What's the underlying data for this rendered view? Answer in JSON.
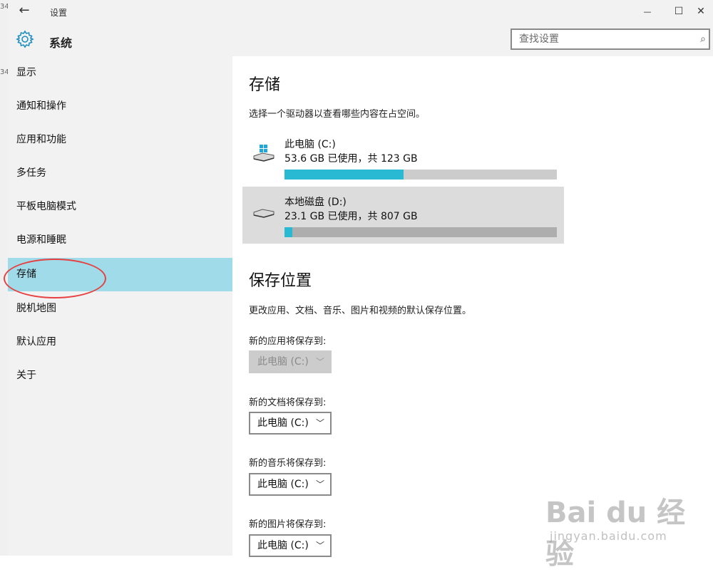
{
  "behind": {
    "texts": [
      "34",
      "34"
    ]
  },
  "window": {
    "title": "设置",
    "back_glyph": "←",
    "minimize": "—",
    "maximize": "☐",
    "close": "✕"
  },
  "header": {
    "title": "系统",
    "search_placeholder": "查找设置"
  },
  "sidebar": {
    "items": [
      {
        "label": "显示"
      },
      {
        "label": "通知和操作"
      },
      {
        "label": "应用和功能"
      },
      {
        "label": "多任务"
      },
      {
        "label": "平板电脑模式"
      },
      {
        "label": "电源和睡眠"
      },
      {
        "label": "存储",
        "active": true
      },
      {
        "label": "脱机地图"
      },
      {
        "label": "默认应用"
      },
      {
        "label": "关于"
      }
    ]
  },
  "storage": {
    "title": "存储",
    "description": "选择一个驱动器以查看哪些内容在占空间。",
    "drives": [
      {
        "name": "此电脑 (C:)",
        "usage": "53.6 GB 已使用，共 123 GB",
        "used_fraction": 0.436,
        "selected": false
      },
      {
        "name": "本地磁盘 (D:)",
        "usage": "23.1 GB 已使用，共 807 GB",
        "used_fraction": 0.029,
        "selected": true
      }
    ]
  },
  "save_locations": {
    "title": "保存位置",
    "description": "更改应用、文档、音乐、图片和视频的默认保存位置。",
    "items": [
      {
        "label": "新的应用将保存到:",
        "value": "此电脑 (C:)",
        "disabled": true
      },
      {
        "label": "新的文档将保存到:",
        "value": "此电脑 (C:)",
        "disabled": false
      },
      {
        "label": "新的音乐将保存到:",
        "value": "此电脑 (C:)",
        "disabled": false
      },
      {
        "label": "新的图片将保存到:",
        "value": "此电脑 (C:)",
        "disabled": false
      }
    ]
  },
  "colors": {
    "accent": "#29b9d2",
    "active_nav": "#9fdbe9",
    "annotation": "#e64040"
  },
  "watermark": {
    "logo": "Bai du 经验",
    "url": "jingyan.baidu.com"
  }
}
